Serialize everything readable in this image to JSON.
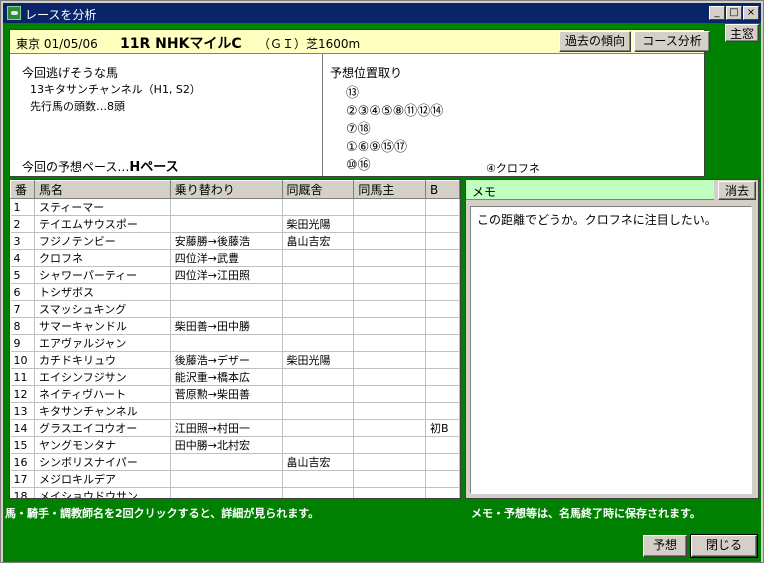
{
  "window": {
    "title": "レースを分析"
  },
  "race": {
    "date": "東京 01/05/06",
    "name": "11R NHKマイルC",
    "grade": "（ＧＩ）芝1600m"
  },
  "buttons": {
    "trend": "過去の傾向",
    "course": "コース分析",
    "main_window": "主窓",
    "clear": "消去",
    "predict": "予想",
    "close": "閉じる"
  },
  "analysis": {
    "escape_label": "今回逃げそうな馬",
    "escape_horse": "13キタサンチャンネル（H1, S2）",
    "front_count": "先行馬の頭数…8頭",
    "pace_label": "今回の予想ペース…",
    "pace_value": "Hペース"
  },
  "position": {
    "label": "予想位置取り",
    "rows": [
      "⑬",
      "②③④⑤⑧⑪⑫⑭",
      "⑦⑱",
      "①⑥⑨⑮⑰",
      "⑩⑯"
    ],
    "note": "④クロフネ"
  },
  "table": {
    "headers": [
      "番",
      "馬名",
      "乗り替わり",
      "同厩舎",
      "同馬主",
      "B"
    ],
    "rows": [
      [
        "1",
        "スティーマー",
        "",
        "",
        "",
        ""
      ],
      [
        "2",
        "テイエムサウスポー",
        "",
        "柴田光陽",
        "",
        ""
      ],
      [
        "3",
        "フジノテンビー",
        "安藤勝→後藤浩",
        "畠山吉宏",
        "",
        ""
      ],
      [
        "4",
        "クロフネ",
        "四位洋→武豊",
        "",
        "",
        ""
      ],
      [
        "5",
        "シャワーパーティー",
        "四位洋→江田照",
        "",
        "",
        ""
      ],
      [
        "6",
        "トシザボス",
        "",
        "",
        "",
        ""
      ],
      [
        "7",
        "スマッシュキング",
        "",
        "",
        "",
        ""
      ],
      [
        "8",
        "サマーキャンドル",
        "柴田善→田中勝",
        "",
        "",
        ""
      ],
      [
        "9",
        "エアヴァルジャン",
        "",
        "",
        "",
        ""
      ],
      [
        "10",
        "カチドキリュウ",
        "後藤浩→デザー",
        "柴田光陽",
        "",
        ""
      ],
      [
        "11",
        "エイシンフジサン",
        "能沢重→橋本広",
        "",
        "",
        ""
      ],
      [
        "12",
        "ネイティヴハート",
        "菅原勲→柴田善",
        "",
        "",
        ""
      ],
      [
        "13",
        "キタサンチャンネル",
        "",
        "",
        "",
        ""
      ],
      [
        "14",
        "グラスエイコウオー",
        "江田照→村田一",
        "",
        "",
        "初B"
      ],
      [
        "15",
        "ヤングモンタナ",
        "田中勝→北村宏",
        "",
        "",
        ""
      ],
      [
        "16",
        "シンボリスナイパー",
        "",
        "畠山吉宏",
        "",
        ""
      ],
      [
        "17",
        "メジロキルデア",
        "",
        "",
        "",
        ""
      ],
      [
        "18",
        "メイショウドウサン",
        "",
        "",
        "",
        ""
      ]
    ]
  },
  "memo": {
    "label": "メモ",
    "text": "この距離でどうか。クロフネに注目したい。"
  },
  "footer": {
    "left_note": "馬・騎手・調教師名を2回クリックすると、詳細が見られます。",
    "right_note": "メモ・予想等は、名馬終了時に保存されます。"
  }
}
